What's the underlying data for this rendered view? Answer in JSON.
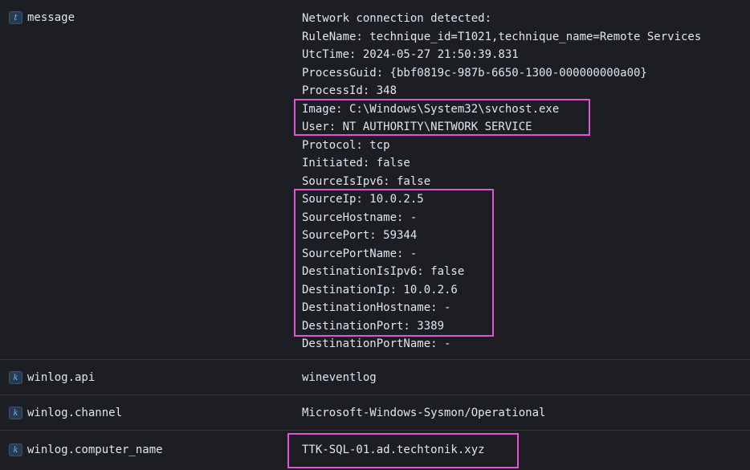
{
  "rows": [
    {
      "type": "t",
      "field": "message",
      "lines": [
        "Network connection detected:",
        "RuleName: technique_id=T1021,technique_name=Remote Services",
        "UtcTime: 2024-05-27 21:50:39.831",
        "ProcessGuid: {bbf0819c-987b-6650-1300-000000000a00}",
        "ProcessId: 348",
        "Image: C:\\Windows\\System32\\svchost.exe",
        "User: NT AUTHORITY\\NETWORK SERVICE",
        "Protocol: tcp",
        "Initiated: false",
        "SourceIsIpv6: false",
        "SourceIp: 10.0.2.5",
        "SourceHostname: -",
        "SourcePort: 59344",
        "SourcePortName: -",
        "DestinationIsIpv6: false",
        "DestinationIp: 10.0.2.6",
        "DestinationHostname: -",
        "DestinationPort: 3389",
        "DestinationPortName: -"
      ]
    },
    {
      "type": "k",
      "field": "winlog.api",
      "value": "wineventlog"
    },
    {
      "type": "k",
      "field": "winlog.channel",
      "value": "Microsoft-Windows-Sysmon/Operational"
    },
    {
      "type": "k",
      "field": "winlog.computer_name",
      "value": "TTK-SQL-01.ad.techtonik.xyz"
    }
  ],
  "colors": {
    "background": "#1d1e24",
    "text": "#dfe5ef",
    "divider": "#343741",
    "highlight": "#e055d6",
    "badge_bg": "#263a50",
    "badge_text": "#7fb3e6"
  },
  "icons": {
    "text_type": "text-field-type-icon",
    "keyword_type": "keyword-field-type-icon"
  }
}
